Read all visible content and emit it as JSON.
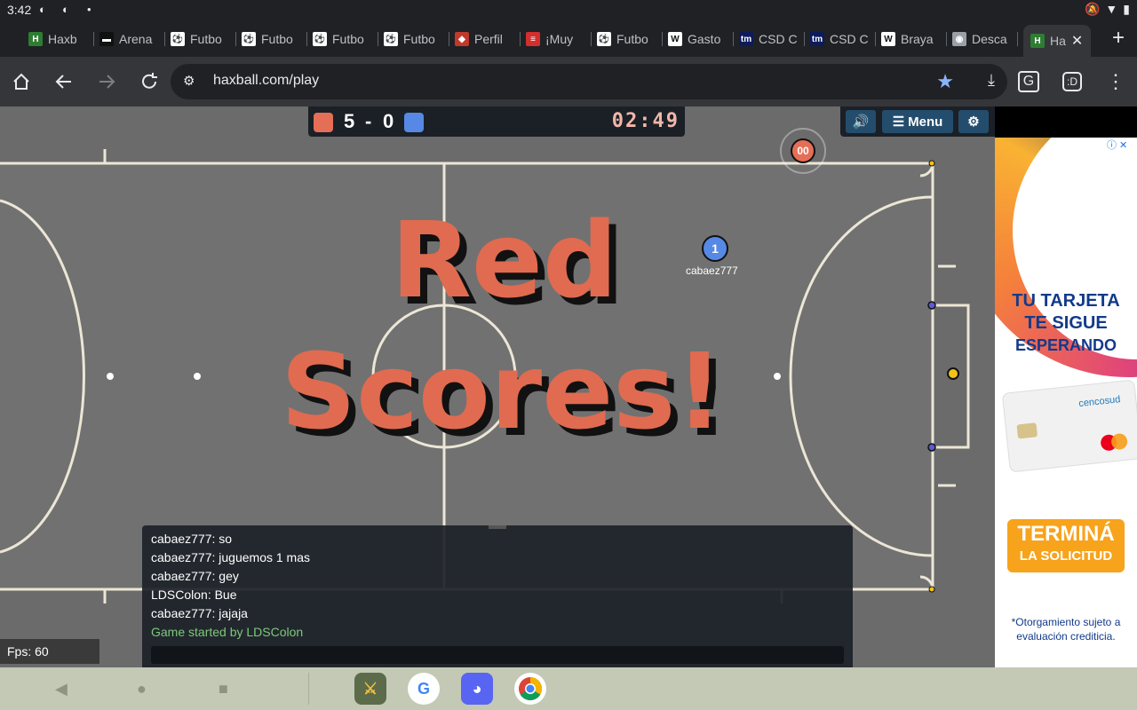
{
  "status_bar": {
    "time": "3:42"
  },
  "tabs": [
    {
      "label": "Haxb",
      "fav_color": "#2e7d32",
      "fav_glyph": "H"
    },
    {
      "label": "Arena",
      "fav_color": "#111111",
      "fav_glyph": "▬"
    },
    {
      "label": "Futbo",
      "fav_color": "#ffffff",
      "fav_glyph": "⚽"
    },
    {
      "label": "Futbo",
      "fav_color": "#ffffff",
      "fav_glyph": "⚽"
    },
    {
      "label": "Futbo",
      "fav_color": "#ffffff",
      "fav_glyph": "⚽"
    },
    {
      "label": "Futbo",
      "fav_color": "#ffffff",
      "fav_glyph": "⚽"
    },
    {
      "label": "Perfil",
      "fav_color": "#c0392b",
      "fav_glyph": "◆"
    },
    {
      "label": "¡Muy",
      "fav_color": "#d32f2f",
      "fav_glyph": "≡"
    },
    {
      "label": "Futbo",
      "fav_color": "#ffffff",
      "fav_glyph": "⚽"
    },
    {
      "label": "Gasto",
      "fav_color": "#ffffff",
      "fav_glyph": "W"
    },
    {
      "label": "CSD C",
      "fav_color": "#0d1b5c",
      "fav_glyph": "tm"
    },
    {
      "label": "CSD C",
      "fav_color": "#0d1b5c",
      "fav_glyph": "tm"
    },
    {
      "label": "Braya",
      "fav_color": "#ffffff",
      "fav_glyph": "W"
    },
    {
      "label": "Desca",
      "fav_color": "#9aa0a6",
      "fav_glyph": "◉"
    },
    {
      "label": "Ha",
      "fav_color": "#2e7d32",
      "fav_glyph": "H",
      "active": true
    }
  ],
  "toolbar": {
    "url": "haxball.com/play"
  },
  "game": {
    "score_red": "5",
    "score_sep": "-",
    "score_blue": "0",
    "clock": "02:49",
    "menu_label": "Menu",
    "red_team_color": "#e56e56",
    "blue_team_color": "#5689e5",
    "overlay_line1": "Red",
    "overlay_line2": "Scores!",
    "player_blue_number": "1",
    "player_blue_name": "cabaez777",
    "player_red_number": "00",
    "fps": "Fps: 60"
  },
  "chat": {
    "lines": [
      {
        "text": "cabaez777: so"
      },
      {
        "text": "cabaez777: juguemos 1 mas"
      },
      {
        "text": "cabaez777: gey"
      },
      {
        "text": "LDSColon: Bue"
      },
      {
        "text": "cabaez777: jajaja"
      },
      {
        "text": "Game started by LDSColon"
      }
    ]
  },
  "ad": {
    "headline_1": "TU TARJETA",
    "headline_2": "TE SIGUE",
    "headline_3": "ESPERANDO",
    "card_brand": "cencosud",
    "cta_1": "TERMINÁ",
    "cta_2": "LA SOLICITUD",
    "fine_print": "*Otorgamiento sujeto a evaluación crediticia."
  }
}
